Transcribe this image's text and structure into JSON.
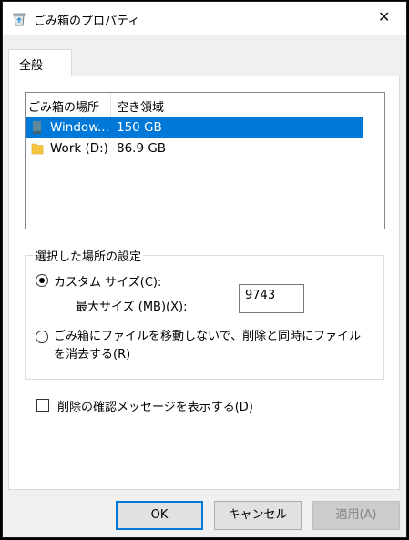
{
  "window": {
    "title": "ごみ箱のプロパティ"
  },
  "tabs": [
    {
      "label": "全般"
    }
  ],
  "list": {
    "columns": [
      "ごみ箱の場所",
      "空き領域"
    ],
    "rows": [
      {
        "name": "Window...",
        "size": "150 GB",
        "selected": true,
        "icon": "drive-icon"
      },
      {
        "name": "Work (D:)",
        "size": "86.9 GB",
        "selected": false,
        "icon": "folder-icon"
      }
    ]
  },
  "settings": {
    "legend": "選択した場所の設定",
    "custom_size_label": "カスタム サイズ(C):",
    "max_size_label": "最大サイズ (MB)(X):",
    "max_size_value": "9743",
    "delete_immediately_label": "ごみ箱にファイルを移動しないで、削除と同時にファイルを消去する(R)"
  },
  "confirm_checkbox_label": "削除の確認メッセージを表示する(D)",
  "buttons": {
    "ok": "OK",
    "cancel": "キャンセル",
    "apply": "適用(A)"
  },
  "colors": {
    "selection": "#0078d7",
    "folder": "#f5c542",
    "drive": "#6b8e9e"
  }
}
